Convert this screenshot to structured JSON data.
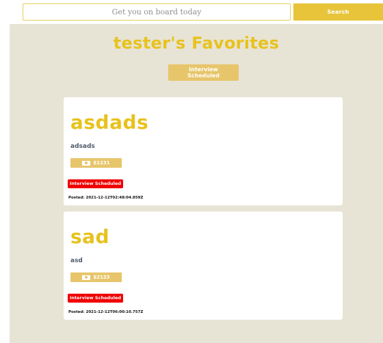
{
  "search": {
    "placeholder": "Get you on board today",
    "button_label": "Search"
  },
  "page": {
    "title": "tester's Favorites",
    "filter_label": "Interview Scheduled"
  },
  "colors": {
    "accent": "#e8c21d",
    "badge_bg": "#e7c56a",
    "status_red": "#f00000",
    "page_bg": "#e7e4d5"
  },
  "favorites": [
    {
      "title": "asdads",
      "company": "adsads",
      "salary_icon": "money-icon",
      "salary": "$1231",
      "status": "Interview Scheduled",
      "posted": "Posted: 2021-12-12T02:48:04.859Z"
    },
    {
      "title": "sad",
      "company": "asd",
      "salary_icon": "money-icon",
      "salary": "$2133",
      "status": "Interview Scheduled",
      "posted": "Posted: 2021-12-12T06:00:10.757Z"
    }
  ]
}
